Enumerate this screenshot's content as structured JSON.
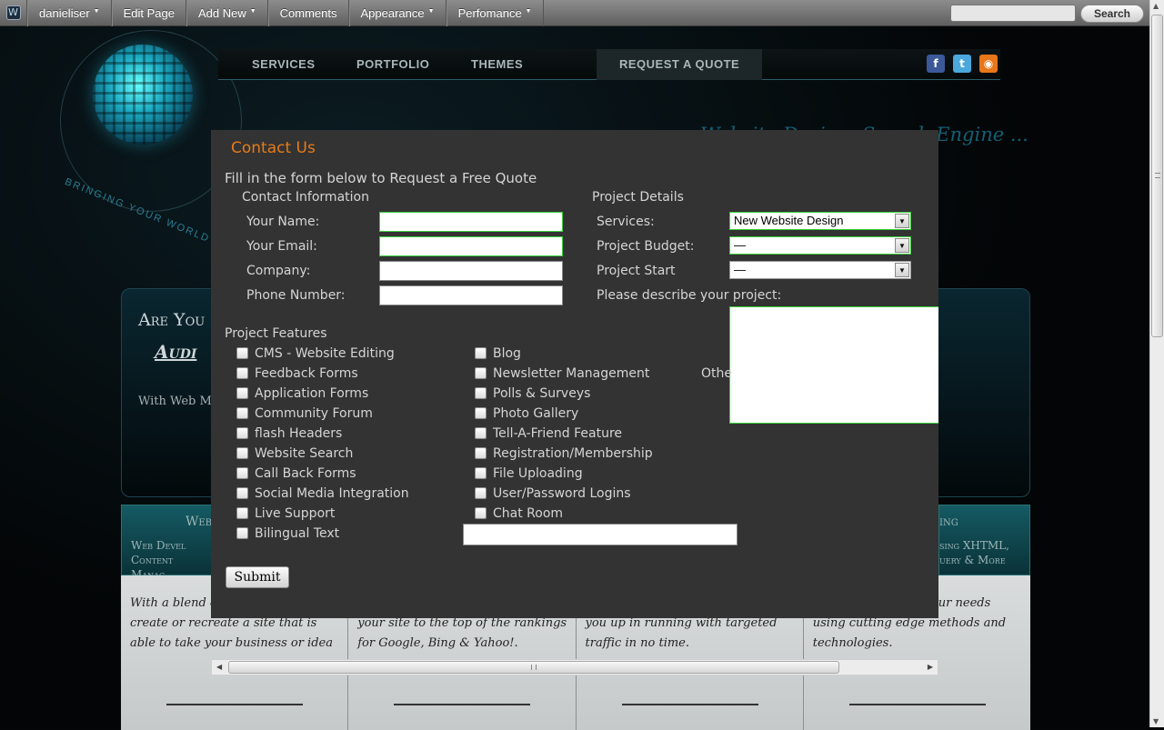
{
  "adminbar": {
    "menu": [
      {
        "label": "danieliser",
        "dropdown": true
      },
      {
        "label": "Edit Page",
        "dropdown": false
      },
      {
        "label": "Add New",
        "dropdown": true
      },
      {
        "label": "Comments",
        "dropdown": false
      },
      {
        "label": "Appearance",
        "dropdown": true
      },
      {
        "label": "Perfomance",
        "dropdown": true
      }
    ],
    "search_value": "",
    "search_button": "Search"
  },
  "site": {
    "logo_tagline": "BRINGING YOUR WORLD TOGETHER",
    "nav": [
      "SERVICES",
      "PORTFOLIO",
      "THEMES",
      "REQUEST A QUOTE"
    ],
    "social_icons": [
      "facebook-icon",
      "twitter-icon",
      "rss-icon"
    ],
    "hero_tagline": "Website Design, Search Engine ... Marketing",
    "panel_title": "Are You",
    "panel_subtitle": "Audi",
    "panel_text": "With Web Marketing a can help to get every po",
    "tabs": [
      {
        "title": "Web",
        "sub": "Web Devel Content Manag"
      },
      {
        "title": "ing",
        "sub": "sing XHTML, uery & More"
      }
    ],
    "cards": [
      "With a blend of creativity we can create or recreate a site that is able to take your business or idea",
      "your site to the top of the rankings for Google, Bing & Yahoo!.",
      "you up in running with targeted traffic in no time.",
      "a solution to meet your needs using cutting edge methods and technologies."
    ]
  },
  "modal": {
    "title": "Contact Us",
    "intro": "Fill in the form below to Request a Free Quote",
    "contact_heading": "Contact Information",
    "contact_fields": [
      {
        "label": "Your Name:",
        "value": ""
      },
      {
        "label": "Your Email:",
        "value": ""
      },
      {
        "label": "Company:",
        "value": ""
      },
      {
        "label": "Phone Number:",
        "value": ""
      }
    ],
    "project_heading": "Project Details",
    "services_label": "Services:",
    "services_value": "New Website Design",
    "budget_label": "Project Budget:",
    "budget_value": "—",
    "start_label": "Project Start",
    "start_value": "—",
    "describe_label": "Please describe your project:",
    "describe_value": "",
    "features_heading": "Project Features",
    "features_col1": [
      "CMS - Website Editing",
      "Feedback Forms",
      "Application Forms",
      "Community Forum",
      "flash Headers",
      "Website Search",
      "Call Back Forms",
      "Social Media Integration",
      "Live Support",
      "Bilingual Text"
    ],
    "features_col2": [
      "Blog",
      "Newsletter Management",
      "Polls & Surveys",
      "Photo Gallery",
      "Tell-A-Friend Feature",
      "Registration/Membership",
      "File Uploading",
      "User/Password Logins",
      "Chat Room"
    ],
    "other_label": "Othe",
    "other_value": "",
    "submit_label": "Submit"
  }
}
